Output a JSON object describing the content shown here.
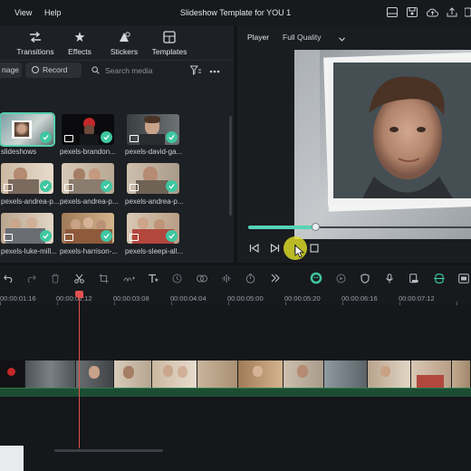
{
  "menubar": {
    "items": [
      "View",
      "Help"
    ],
    "title": "Slideshow Template for YOU 1"
  },
  "media": {
    "tabs": [
      {
        "label": "Transitions",
        "icon": "transitions-icon"
      },
      {
        "label": "Effects",
        "icon": "effects-icon"
      },
      {
        "label": "Stickers",
        "icon": "stickers-icon"
      },
      {
        "label": "Templates",
        "icon": "templates-icon"
      }
    ],
    "manage_label": "nage",
    "record_label": "Record",
    "search_placeholder": "Search media",
    "items": [
      {
        "caption": "slideshows",
        "selected": true,
        "check": true
      },
      {
        "caption": "pexels-brandon...",
        "selected": false,
        "check": true
      },
      {
        "caption": "pexels-david-ga...",
        "selected": false,
        "check": true
      },
      {
        "caption": "pexels-andrea-p...",
        "selected": false,
        "check": true
      },
      {
        "caption": "pexels-andrea-p...",
        "selected": false,
        "check": true
      },
      {
        "caption": "pexels-andrea-p...",
        "selected": false,
        "check": true
      },
      {
        "caption": "pexels-luke-mill...",
        "selected": false,
        "check": true
      },
      {
        "caption": "pexels-harrison-...",
        "selected": false,
        "check": true
      },
      {
        "caption": "pexels-sleepi-all...",
        "selected": false,
        "check": true
      }
    ]
  },
  "player": {
    "label": "Player",
    "quality": "Full Quality",
    "progress": 0.3
  },
  "timeline": {
    "ruler": [
      "00:00:01:16",
      "00:00:02:12",
      "00:00:03:08",
      "00:00:04:04",
      "00:00:05:00",
      "00:00:05:20",
      "00:00:06:16",
      "00:00:07:12"
    ]
  },
  "colors": {
    "accent": "#55d4b6",
    "playhead": "#e45050",
    "highlight": "#dede28"
  }
}
